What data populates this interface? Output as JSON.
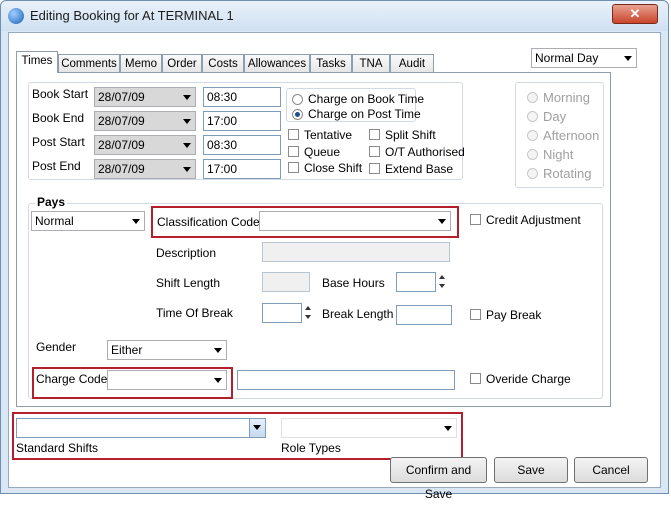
{
  "window": {
    "title": "Editing Booking for  At TERMINAL 1",
    "close_glyph": "✕"
  },
  "tabs": [
    "Times",
    "Comments",
    "Memo",
    "Order",
    "Costs",
    "Allowances",
    "Tasks",
    "TNA",
    "Audit"
  ],
  "day_type": "Normal Day",
  "times": {
    "book_start": {
      "label": "Book Start",
      "date": "28/07/09",
      "time": "08:30"
    },
    "book_end": {
      "label": "Book End",
      "date": "28/07/09",
      "time": "17:00"
    },
    "post_start": {
      "label": "Post Start",
      "date": "28/07/09",
      "time": "08:30"
    },
    "post_end": {
      "label": "Post End",
      "date": "28/07/09",
      "time": "17:00"
    }
  },
  "charge_options": [
    "Charge on Book Time",
    "Charge on Post Time"
  ],
  "charge_selected": "Charge on Post Time",
  "flags": {
    "tentative": "Tentative",
    "split_shift": "Split Shift",
    "queue": "Queue",
    "ot_authorised": "O/T Authorised",
    "close_shift": "Close Shift",
    "extend_base": "Extend Base"
  },
  "shift_periods": [
    "Morning",
    "Day",
    "Afternoon",
    "Night",
    "Rotating"
  ],
  "pays": {
    "header": "Pays",
    "pay_type": "Normal",
    "classification_label": "Classification Code",
    "classification_value": "",
    "credit_adjustment": "Credit Adjustment",
    "description_label": "Description",
    "shift_length_label": "Shift Length",
    "base_hours_label": "Base Hours",
    "time_of_break_label": "Time Of Break",
    "break_length_label": "Break Length",
    "pay_break": "Pay Break",
    "gender_label": "Gender",
    "gender_value": "Either",
    "charge_code_label": "Charge Code",
    "overide_charge": "Overide Charge"
  },
  "footer": {
    "standard_shifts_label": "Standard Shifts",
    "role_types_label": "Role Types",
    "confirm_save": "Confirm and Save",
    "save": "Save",
    "cancel": "Cancel"
  },
  "colors": {
    "highlight": "#b3202b",
    "accent": "#1c4f8f"
  }
}
